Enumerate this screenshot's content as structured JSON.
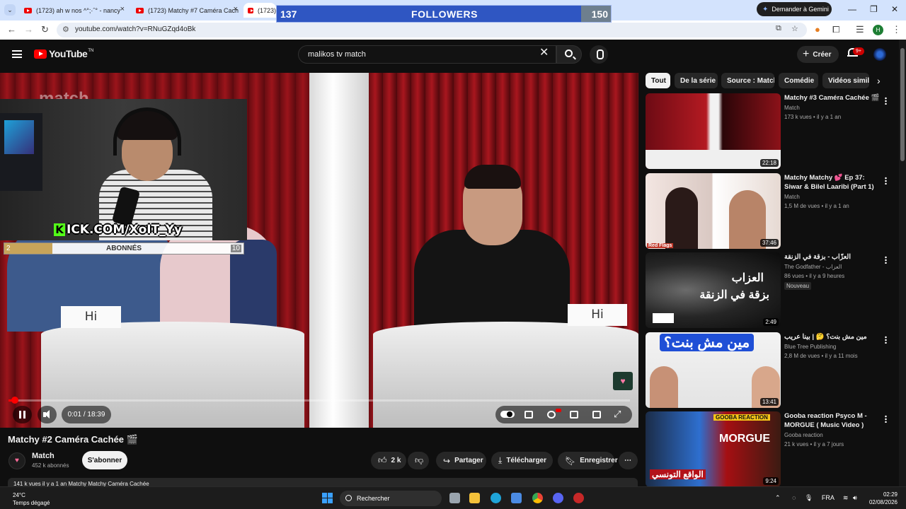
{
  "browser": {
    "tabs": [
      {
        "title": "(1723) ah w nos ^°;·ˆ° - nancy"
      },
      {
        "title": "(1723) Matchy #7 Caméra Cach"
      },
      {
        "title": "(1723)"
      }
    ],
    "gemini_button": "Demander à Gemini",
    "url": "youtube.com/watch?v=RNuGZqd4oBk",
    "profile_initial": "H"
  },
  "stream_overlay": {
    "followers_current": "137",
    "followers_label": "FOLLOWERS",
    "followers_goal": "150",
    "followers_progress": 0.91,
    "kick_channel": "ICK.COM/XoIT_Yy",
    "kick_k": "K",
    "subs_current": "2",
    "subs_label": "ABONNÉS",
    "subs_goal": "10",
    "subs_progress": 0.2
  },
  "youtube": {
    "logo": "YouTube",
    "logo_tm": "TN",
    "search_query": "malikos tv match",
    "create_label": "Créer",
    "notifications_badge": "9+"
  },
  "player": {
    "watermark": "match",
    "card_left": "Hi",
    "card_right": "Hi",
    "time": "0:01 / 18:39",
    "progress": 0.001
  },
  "video": {
    "title": "Matchy #2 Caméra Cachée 🎬",
    "channel": "Match",
    "subscribers": "452 k abonnés",
    "subscribe_label": "S'abonner",
    "likes": "2 k",
    "share_label": "Partager",
    "download_label": "Télécharger",
    "save_label": "Enregistrer",
    "description_peek": "141 k vues  il y a 1 an  Matchy Matchy Caméra Cachée"
  },
  "chips": [
    "Tout",
    "De la série",
    "Source : Match",
    "Comédie",
    "Vidéos simil"
  ],
  "recommendations": [
    {
      "title": "Matchy #3 Caméra Cachée 🎬",
      "channel": "Match",
      "meta": "173 k vues • il y a 1 an",
      "duration": "22:18"
    },
    {
      "title": "Matchy Matchy 💕 Ep 37: Siwar & Bilel Laaribi (Part 1)",
      "channel": "Match",
      "meta": "1,5 M de vues • il y a 1 an",
      "duration": "37:46",
      "thumb_label": "Red Flags"
    },
    {
      "title": "العزّاب - بزقة في الزنقة",
      "channel": "The Godfather - العزاب",
      "meta": "86 vues • il y a 9 heures",
      "badge": "Nouveau",
      "duration": "2:49",
      "thumb_text_1": "العزاب",
      "thumb_text_2": "بزقة في الزنقة"
    },
    {
      "title": "مين مش بنت؟ 🤔 | بينا عريب",
      "channel": "Blue Tree Publishing",
      "meta": "2,8 M de vues • il y a 11 mois",
      "duration": "13:41",
      "thumb_text_1": "مين مش بنت؟"
    },
    {
      "title": "Gooba reaction Psyco M - MORGUE ( Music Video )",
      "channel": "Gooba reaction",
      "meta": "21 k vues • il y a 7 jours",
      "duration": "9:24",
      "thumb_text_1": "GOOBA REACTION",
      "thumb_text_2": "MORGUE",
      "thumb_text_3": "الواقع التونسي"
    }
  ],
  "taskbar": {
    "temperature": "24°C",
    "weather": "Temps dégagé",
    "search_label": "Rechercher",
    "language": "FRA",
    "time": "02:29",
    "date": "02/08/2026"
  },
  "colors": {
    "followers_bar": "#2f56c2",
    "kick_green": "#53fc18",
    "youtube_red": "#ff0000"
  }
}
